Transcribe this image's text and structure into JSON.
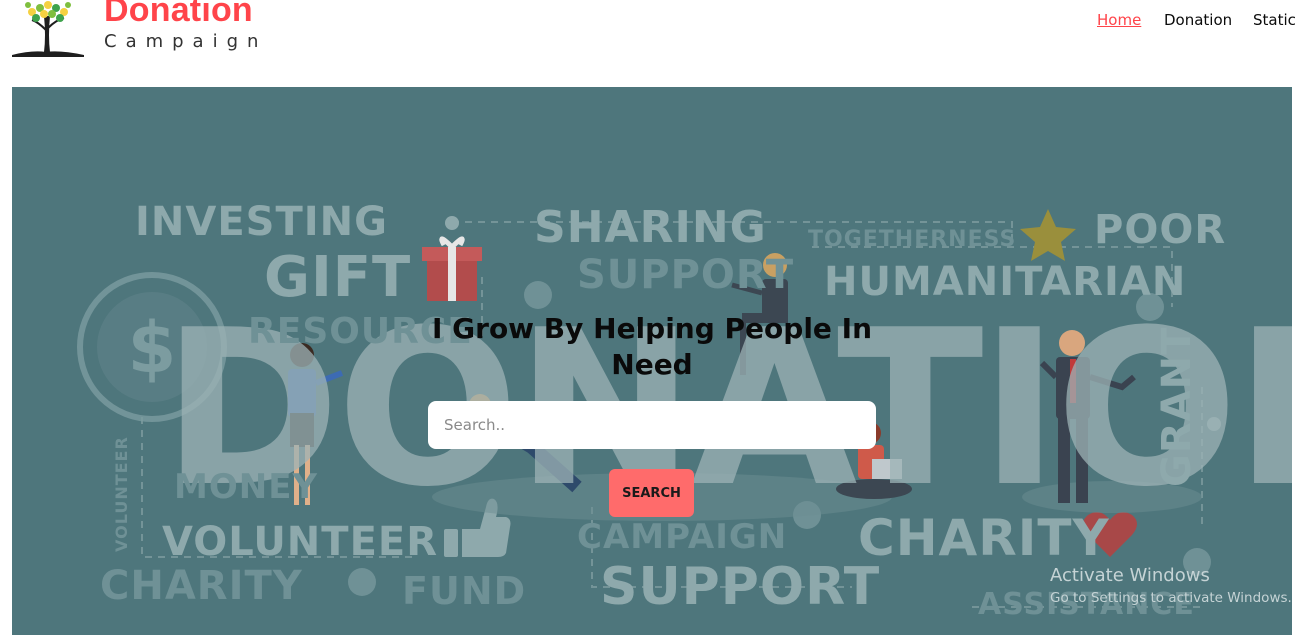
{
  "brand": {
    "title": "Donation",
    "subtitle": "Campaign"
  },
  "nav": {
    "items": [
      {
        "label": "Home",
        "active": true
      },
      {
        "label": "Donation",
        "active": false
      },
      {
        "label": "Static",
        "active": false
      }
    ]
  },
  "hero": {
    "headline_line1": "I Grow By Helping People In",
    "headline_line2": "Need",
    "search_placeholder": "Search..",
    "search_button": "SEARCH",
    "background_words": {
      "big": "DONATION",
      "investing": "INVESTING",
      "sharing": "SHARING",
      "togetherness": "TOGETHERNESS",
      "poor": "POOR",
      "gift": "GIFT",
      "support_top": "SUPPORT",
      "humanitarian": "HUMANITARIAN",
      "resource": "RESOURCE",
      "grant": "GRANT",
      "volunteer": "VOLUNTEER",
      "volunteer_vertical": "VOLUNTEER",
      "charity_left": "CHARITY",
      "fund": "FUND",
      "campaign": "CAMPAIGN",
      "support_bottom": "SUPPORT",
      "charity_right": "CHARITY",
      "assistance": "ASSISTANCE",
      "money": "MONEY"
    }
  },
  "watermark": {
    "title": "Activate Windows",
    "subtitle": "Go to Settings to activate Windows."
  },
  "colors": {
    "brand_accent": "#ff444a",
    "banner_bg": "#4e767c",
    "search_button_bg": "#ff6b6b"
  },
  "icons": [
    "tree-logo-icon",
    "gift-icon",
    "star-icon",
    "heart-icon",
    "thumbs-up-icon",
    "dollar-coin-icon"
  ]
}
